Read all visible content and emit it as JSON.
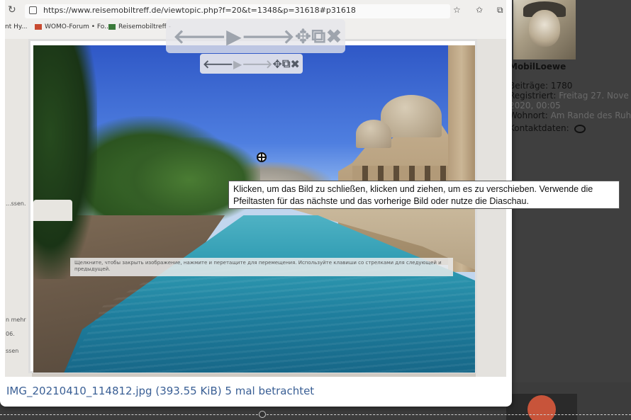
{
  "browser": {
    "url": "https://www.reisemobiltreff.de/viewtopic.php?f=20&t=1348&p=31618#p31618",
    "bookmarks": [
      "nt Hy...",
      "WOMO-Forum • Fo...",
      "Reisemobiltreff -"
    ]
  },
  "profile": {
    "username": "MobilLoewe",
    "posts_label": "Beiträge:",
    "posts_value": "1780",
    "registered_label": "Registriert:",
    "registered_value": "Freitag 27. Nove",
    "registered_value2": "2020, 00:05",
    "location_label": "Wohnort:",
    "location_value": "Am Rande des Ruh",
    "contact_label": "Kontaktdaten:"
  },
  "inner_page": {
    "side_texts": [
      "...ssen.",
      "n mehr",
      "06.",
      "ssen"
    ],
    "inner_caption": "Щелкните, чтобы закрыть изображение, нажмите и перетащите для перемещения. Используйте клавиши со стрелками для следующей и предыдущей."
  },
  "tooltip": {
    "text": "Klicken, um das Bild zu schließen, klicken und ziehen, um es zu verschieben. Verwende die Pfeiltasten für das nächste und das vorherige Bild oder nutze die Diaschau."
  },
  "nav": {
    "prev": "🡐",
    "play": "▶",
    "next": "🡒",
    "move": "✥",
    "open": "⧉",
    "close": "✖"
  },
  "lightbox": {
    "filename": "IMG_20210410_114812.jpg",
    "filesize": "(393.55 KiB)",
    "views": "5 mal betrachtet"
  },
  "icons": [
    "refresh-icon",
    "lock-icon",
    "prev-arrow-icon",
    "play-icon",
    "next-arrow-icon",
    "move-icon",
    "open-external-icon",
    "close-icon",
    "zoom-cursor-icon",
    "chat-icon"
  ]
}
